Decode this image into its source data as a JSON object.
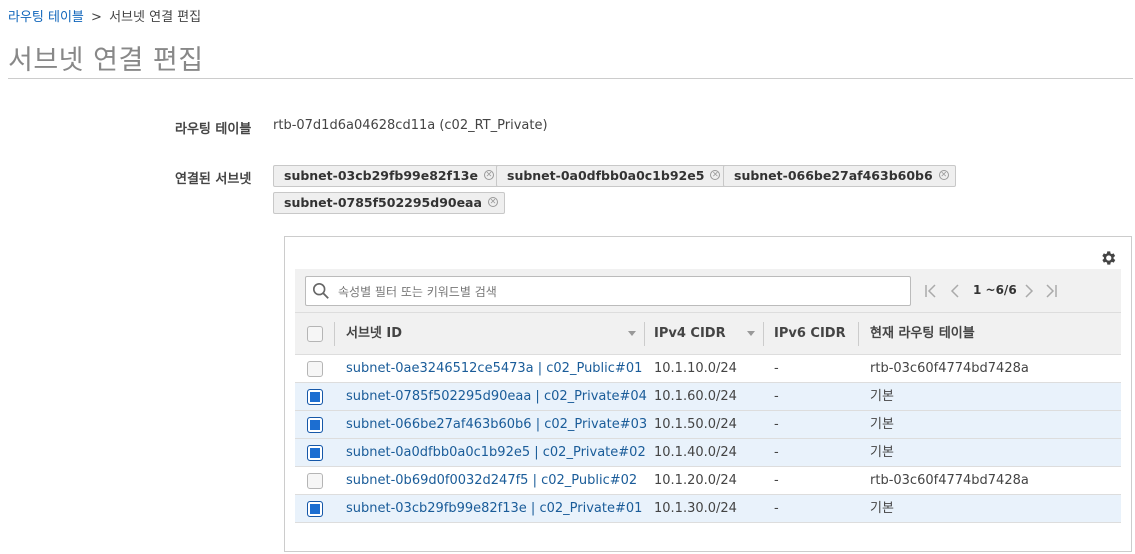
{
  "breadcrumb": {
    "parent": "라우팅 테이블",
    "separator": ">",
    "current": "서브넷 연결 편집"
  },
  "page_title": "서브넷 연결 편집",
  "route_table": {
    "label": "라우팅 테이블",
    "value": "rtb-07d1d6a04628cd11a (c02_RT_Private)"
  },
  "associated_subnets": {
    "label": "연결된 서브넷",
    "tokens": [
      "subnet-03cb29fb99e82f13e",
      "subnet-0a0dfbb0a0c1b92e5",
      "subnet-066be27af463b60b6",
      "subnet-0785f502295d90eaa"
    ]
  },
  "search": {
    "placeholder": "속성별 필터 또는 키워드별 검색",
    "value": ""
  },
  "pagination": {
    "text": "1 ~6/6"
  },
  "table": {
    "columns": [
      "서브넷 ID",
      "IPv4 CIDR",
      "IPv6 CIDR",
      "현재 라우팅 테이블"
    ],
    "rows": [
      {
        "selected": false,
        "subnet": "subnet-0ae3246512ce5473a | c02_Public#01",
        "ipv4": "10.1.10.0/24",
        "ipv6": "-",
        "route_table": "rtb-03c60f4774bd7428a"
      },
      {
        "selected": true,
        "subnet": "subnet-0785f502295d90eaa | c02_Private#04",
        "ipv4": "10.1.60.0/24",
        "ipv6": "-",
        "route_table": "기본"
      },
      {
        "selected": true,
        "subnet": "subnet-066be27af463b60b6 | c02_Private#03",
        "ipv4": "10.1.50.0/24",
        "ipv6": "-",
        "route_table": "기본"
      },
      {
        "selected": true,
        "subnet": "subnet-0a0dfbb0a0c1b92e5 | c02_Private#02",
        "ipv4": "10.1.40.0/24",
        "ipv6": "-",
        "route_table": "기본"
      },
      {
        "selected": false,
        "subnet": "subnet-0b69d0f0032d247f5 | c02_Public#02",
        "ipv4": "10.1.20.0/24",
        "ipv6": "-",
        "route_table": "rtb-03c60f4774bd7428a"
      },
      {
        "selected": true,
        "subnet": "subnet-03cb29fb99e82f13e | c02_Private#01",
        "ipv4": "10.1.30.0/24",
        "ipv6": "-",
        "route_table": "기본"
      }
    ]
  },
  "colors": {
    "link": "#1166bb",
    "checkbox_selected": "#1c6ed1",
    "selected_row": "#e9f2fb"
  },
  "icons": {
    "settings": "gear-icon",
    "search": "search-icon",
    "token_remove": "close-circle-icon"
  }
}
